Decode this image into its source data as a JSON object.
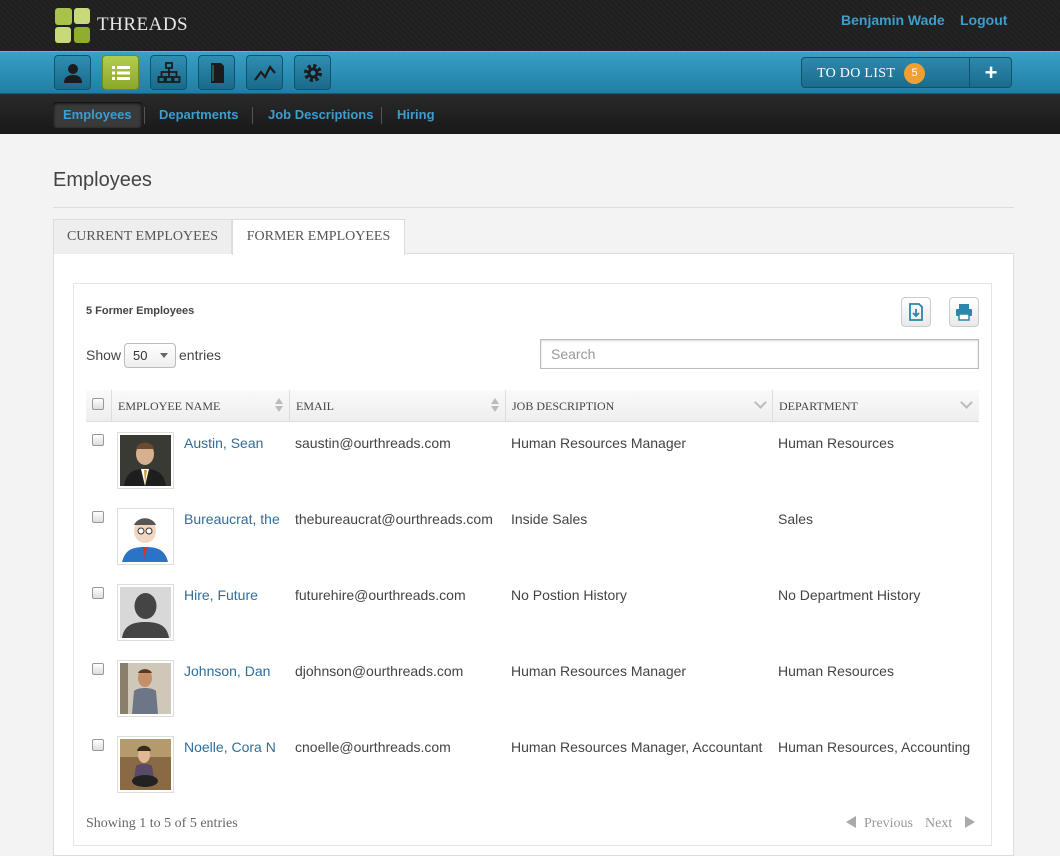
{
  "app": {
    "brand": "THREADS"
  },
  "header": {
    "user_name": "Benjamin Wade",
    "logout": "Logout"
  },
  "toolbar": {
    "icons": [
      "person-icon",
      "list-icon",
      "org-chart-icon",
      "document-icon",
      "chart-icon",
      "gear-icon"
    ],
    "active": "list-icon",
    "todo_label": "TO DO LIST",
    "todo_count": "5",
    "todo_add": "+"
  },
  "subnav": [
    "Employees",
    "Departments",
    "Job Descriptions",
    "Hiring"
  ],
  "page": {
    "title": "Employees"
  },
  "tabs": [
    "CURRENT EMPLOYEES",
    "FORMER EMPLOYEES"
  ],
  "table_controls": {
    "count_label": "5 Former Employees",
    "show": "Show",
    "page_size": "50",
    "entries": "entries",
    "search_placeholder": "Search"
  },
  "table": {
    "columns": [
      "EMPLOYEE NAME",
      "EMAIL",
      "JOB DESCRIPTION",
      "DEPARTMENT"
    ],
    "rows": [
      {
        "name": "Austin, Sean",
        "email": "saustin@ourthreads.com",
        "job": "Human Resources Manager",
        "department": "Human Resources"
      },
      {
        "name": "Bureaucrat, the",
        "email": "thebureaucrat@ourthreads.com",
        "job": "Inside Sales",
        "department": "Sales"
      },
      {
        "name": "Hire, Future",
        "email": "futurehire@ourthreads.com",
        "job": "No Postion History",
        "department": "No Department History"
      },
      {
        "name": "Johnson, Dan",
        "email": "djohnson@ourthreads.com",
        "job": "Human Resources Manager",
        "department": "Human Resources"
      },
      {
        "name": "Noelle, Cora N",
        "email": "cnoelle@ourthreads.com",
        "job": "Human Resources Manager, Accountant",
        "department": "Human Resources, Accounting"
      }
    ]
  },
  "footer": {
    "info": "Showing 1 to 5 of 5 entries",
    "previous": "Previous",
    "next": "Next"
  },
  "colors": {
    "accent": "#3d9dce",
    "toolbar": "#2b8cb2",
    "active_green": "#9dbb3a",
    "todo_badge": "#f0a030"
  }
}
